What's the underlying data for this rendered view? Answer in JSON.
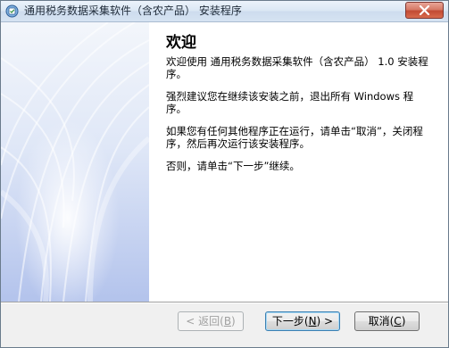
{
  "window": {
    "title": "通用税务数据采集软件（含农产品） 安装程序"
  },
  "wizard": {
    "heading": "欢迎",
    "paragraphs": [
      "欢迎使用 通用税务数据采集软件（含农产品） 1.0 安装程序。",
      "强烈建议您在继续该安装之前，退出所有 Windows 程序。",
      "如果您有任何其他程序正在运行，请单击“取消”，关闭程序，然后再次运行该安装程序。",
      "否则，请单击“下一步”继续。"
    ]
  },
  "buttons": {
    "back": {
      "label": "< 返回(",
      "key": "B",
      "suffix": ")"
    },
    "next": {
      "label": "下一步(",
      "key": "N",
      "suffix": ") >"
    },
    "cancel": {
      "label": "取消(",
      "key": "C",
      "suffix": ")"
    }
  },
  "colors": {
    "side_panel_top": "#eef2fa",
    "side_panel_bottom": "#b9c8ee"
  }
}
